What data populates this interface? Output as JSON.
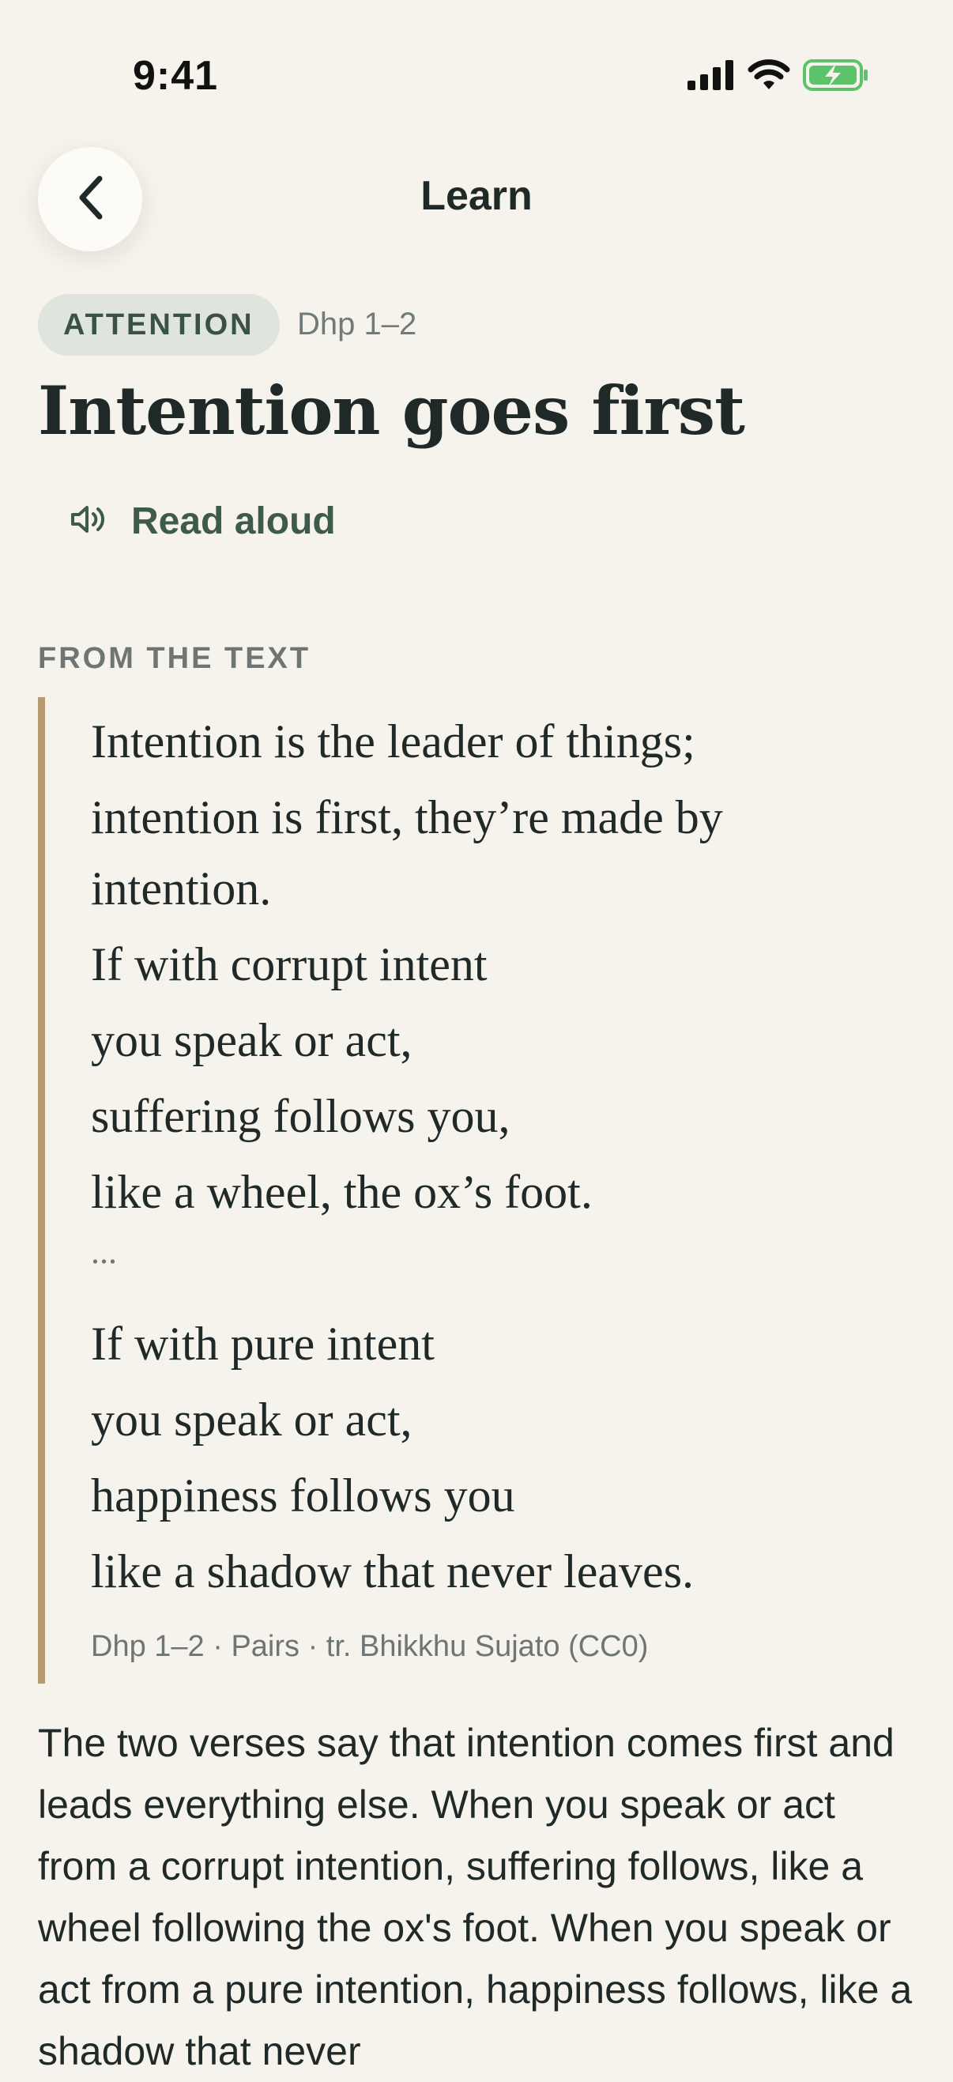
{
  "status_bar": {
    "time": "9:41"
  },
  "header": {
    "title": "Learn"
  },
  "lesson": {
    "tag": "ATTENTION",
    "reference": "Dhp 1–2",
    "title": "Intention goes first",
    "read_aloud_label": "Read aloud"
  },
  "text_section": {
    "label": "FROM THE TEXT",
    "lines": [
      "Intention is the leader of things;",
      "intention is first, they’re made by",
      "intention.",
      "If with corrupt intent",
      "you speak or act,",
      "suffering follows you,",
      "like a wheel, the ox’s foot.",
      "...",
      "If with pure intent",
      "you speak or act,",
      "happiness follows you",
      "like a shadow that never leaves."
    ],
    "citation": "Dhp 1–2 · Pairs · tr. Bhikkhu Sujato (CC0)"
  },
  "explanation": "The two verses say that intention comes first and leads everything else. When you speak or act from a corrupt intention, suffering follows, like a wheel following the ox's foot. When you speak or act from a pure intention, happiness follows, like a shadow that never",
  "colors": {
    "background": "#f6f2ec",
    "accent_green": "#3d5a4b",
    "tag_background": "#dfe4dc",
    "quote_bar": "#b59a72",
    "battery_green": "#5cc36b"
  },
  "icons": {
    "back": "chevron-left-icon",
    "read_aloud": "speaker-icon",
    "signal": "cellular-signal-icon",
    "wifi": "wifi-icon",
    "battery": "battery-charging-icon"
  }
}
